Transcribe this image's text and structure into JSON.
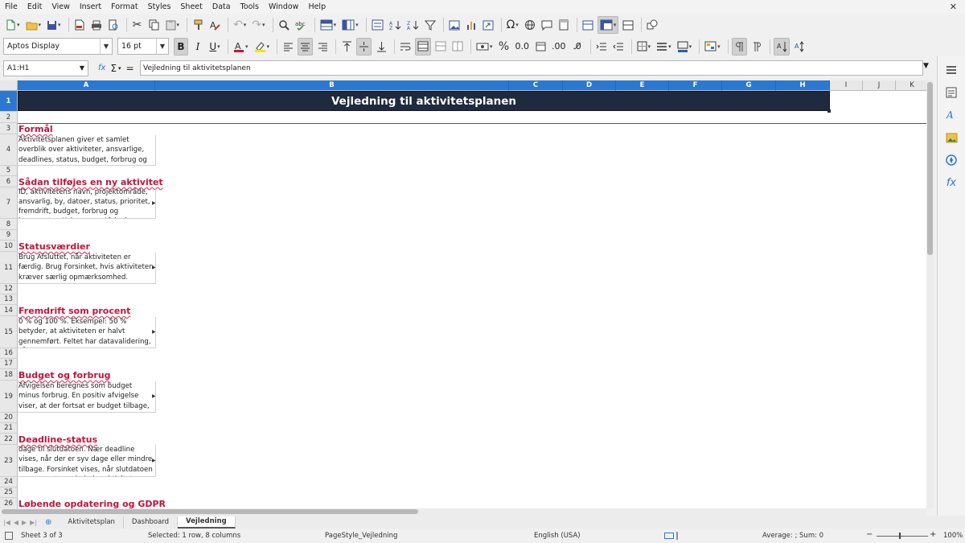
{
  "menubar": {
    "items": [
      "File",
      "Edit",
      "View",
      "Insert",
      "Format",
      "Styles",
      "Sheet",
      "Data",
      "Tools",
      "Window",
      "Help"
    ],
    "close": "✕"
  },
  "toolbar": {
    "font_name": "Aptos Display",
    "font_size": "16 pt"
  },
  "formula_bar": {
    "name_box": "A1:H1",
    "content": "Vejledning til aktivitetsplanen"
  },
  "columns": [
    "A",
    "B",
    "C",
    "D",
    "E",
    "F",
    "G",
    "H",
    "I",
    "J",
    "K"
  ],
  "rows": [
    "1",
    "2",
    "3",
    "4",
    "5",
    "6",
    "7",
    "8",
    "9",
    "10",
    "11",
    "12",
    "13",
    "14",
    "15",
    "16",
    "17",
    "18",
    "19",
    "20",
    "21",
    "22",
    "23",
    "24",
    "25",
    "26"
  ],
  "sheet": {
    "title": "Vejledning til aktivitetsplanen",
    "sections": [
      {
        "heading": "Formål",
        "body": "Aktivitetsplanen giver et samlet overblik over aktiviteter, ansvarlige, deadlines, status, budget, forbrug og fremdrift."
      },
      {
        "heading": "Sådan tilføjes en ny aktivitet",
        "body": "ID, aktivitetens navn, projektområde, ansvarlig, by, datoer, status, prioritet, fremdrift, budget, forbrug og kommentar. Kolonnerne Afvigelse, Dage"
      },
      {
        "heading": "Statusværdier",
        "body": "Brug Afsluttet, når aktiviteten er færdig. Brug Forsinket, hvis aktiviteten kræver særlig opmærksomhed. Deadline-status"
      },
      {
        "heading": "Fremdrift som procent",
        "body": "0 % og 100 %. Eksempel: 50 % betyder, at aktiviteten er halvt gennemført. Feltet har datavalidering, så værdien skal ligge"
      },
      {
        "heading": "Budget og forbrug",
        "body": "Afvigelsen beregnes som budget minus forbrug. En positiv afvigelse viser, at der fortsat er budget tilbage, mens en"
      },
      {
        "heading": "Deadline-status",
        "body": "dage til slutdatoen. Nær deadline vises, når der er syv dage eller mindre tilbage. Forsinket vises, når slutdatoen er passeret, medmindre aktiviteten er"
      },
      {
        "heading": "Løbende opdatering og GDPR",
        "body": ""
      }
    ]
  },
  "sheet_tabs": [
    "Aktivitetsplan",
    "Dashboard",
    "Vejledning"
  ],
  "statusbar": {
    "sheet": "Sheet 3 of 3",
    "selection": "Selected: 1 row, 8 columns",
    "page_style": "PageStyle_Vejledning",
    "language": "English (USA)",
    "summary": "Average: ; Sum: 0",
    "zoom": "100%"
  },
  "colors": {
    "title_bg": "#1f2a3e",
    "heading": "#c0143c",
    "selection": "#2b78d2"
  }
}
